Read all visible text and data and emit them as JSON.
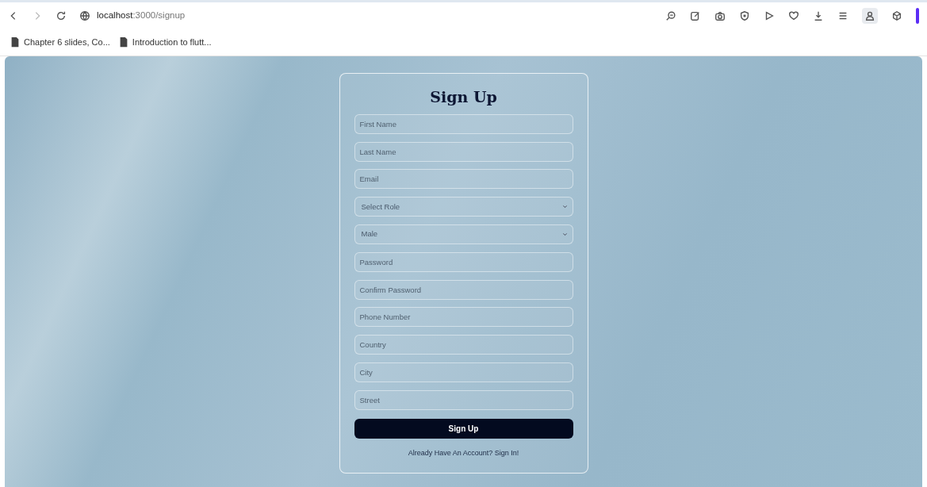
{
  "browser": {
    "url_host": "localhost",
    "url_path": ":3000/signup",
    "bookmarks": [
      {
        "label": "Chapter 6 slides, Co..."
      },
      {
        "label": "Introduction to flutt..."
      }
    ]
  },
  "form": {
    "title": "Sign Up",
    "fields": [
      {
        "kind": "input",
        "placeholder": "First Name"
      },
      {
        "kind": "input",
        "placeholder": "Last Name"
      },
      {
        "kind": "input",
        "placeholder": "Email"
      },
      {
        "kind": "select",
        "value": "Select Role"
      },
      {
        "kind": "select",
        "value": "Male"
      },
      {
        "kind": "input",
        "placeholder": "Password"
      },
      {
        "kind": "input",
        "placeholder": "Confirm Password"
      },
      {
        "kind": "input",
        "placeholder": "Phone Number"
      },
      {
        "kind": "input",
        "placeholder": "Country"
      },
      {
        "kind": "input",
        "placeholder": "City"
      },
      {
        "kind": "input",
        "placeholder": "Street"
      }
    ],
    "submit": "Sign Up",
    "signin_link": "Already Have An Account? Sign In!"
  }
}
